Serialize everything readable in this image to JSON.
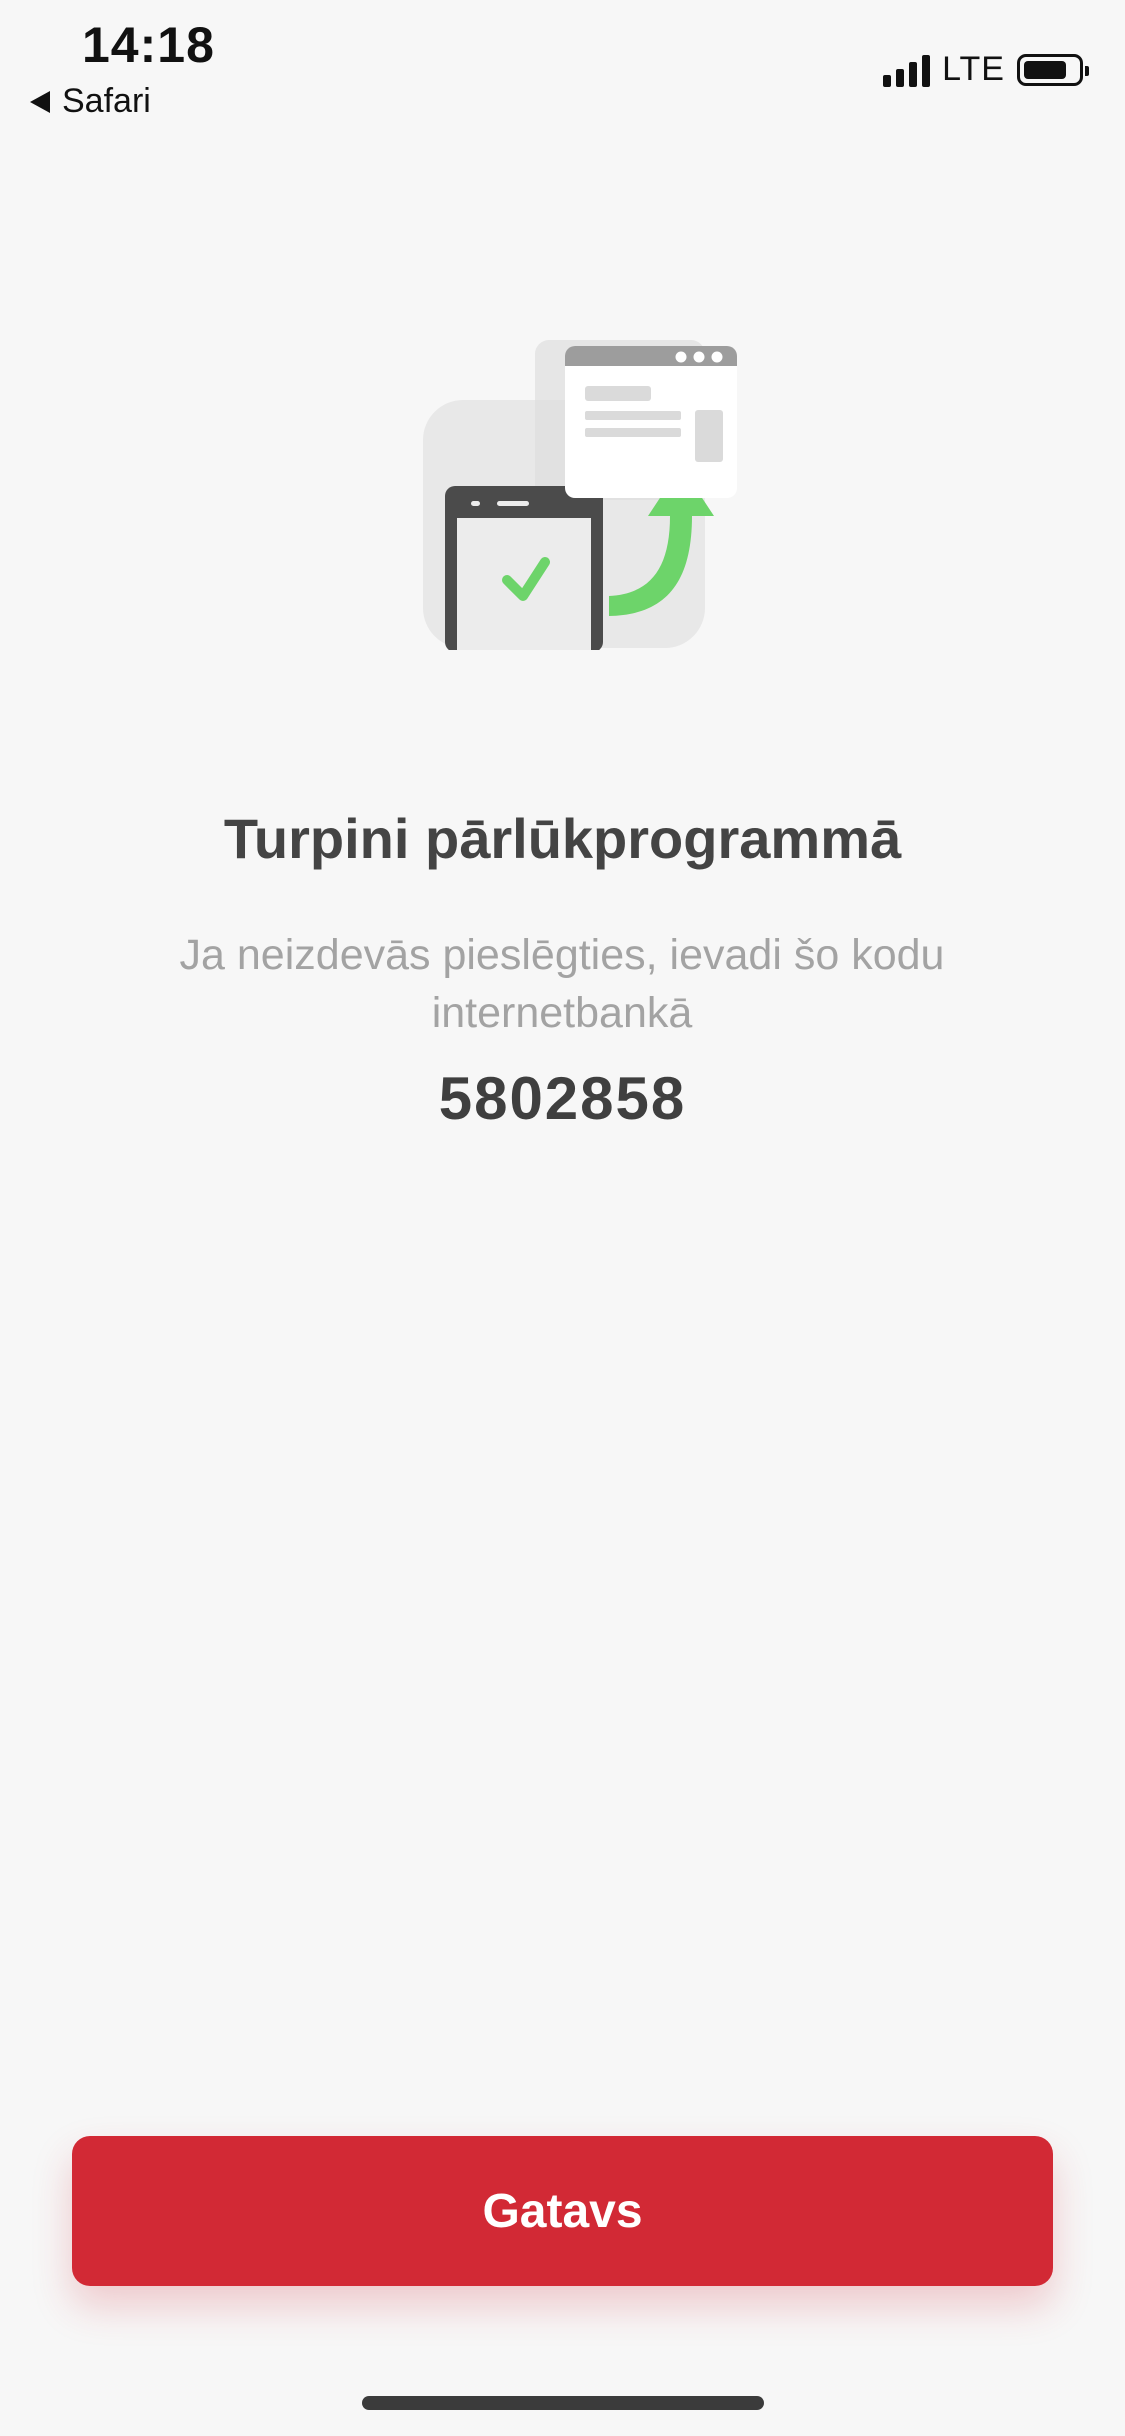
{
  "status_bar": {
    "time": "14:18",
    "back_app": "Safari",
    "network": "LTE"
  },
  "content": {
    "title": "Turpini pārlūkprogrammā",
    "subtitle": "Ja neizdevās pieslēgties, ievadi šo kodu internetbankā",
    "code": "5802858"
  },
  "actions": {
    "done_label": "Gatavs"
  },
  "colors": {
    "primary": "#d22935",
    "accent_green": "#6dd46a",
    "title": "#444444",
    "subtitle": "#a3a3a3",
    "background": "#f7f7f7"
  },
  "icons": {
    "illustration": "phone-to-browser-illustration",
    "checkmark": "checkmark-icon",
    "arrow": "curved-arrow-icon"
  }
}
